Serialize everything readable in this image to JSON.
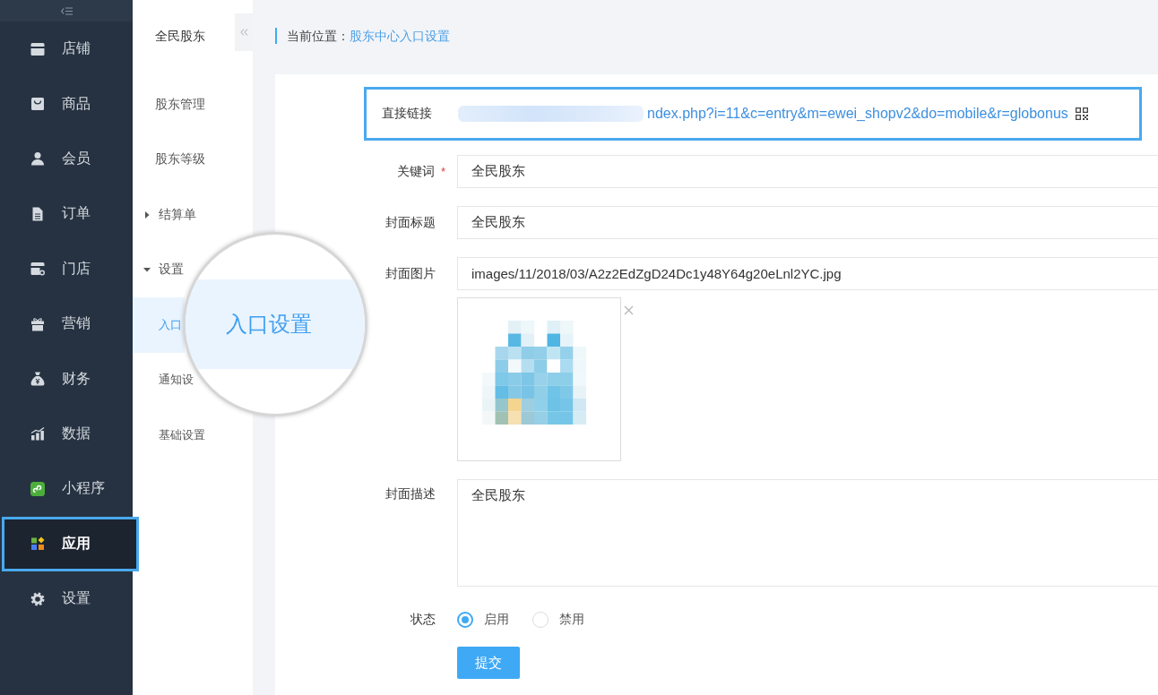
{
  "sidebar": {
    "items": [
      {
        "label": "店铺",
        "selected": false,
        "highlighted": false
      },
      {
        "label": "商品",
        "selected": false,
        "highlighted": false
      },
      {
        "label": "会员",
        "selected": false,
        "highlighted": false
      },
      {
        "label": "订单",
        "selected": false,
        "highlighted": false
      },
      {
        "label": "门店",
        "selected": false,
        "highlighted": false
      },
      {
        "label": "营销",
        "selected": false,
        "highlighted": false
      },
      {
        "label": "财务",
        "selected": false,
        "highlighted": false
      },
      {
        "label": "数据",
        "selected": false,
        "highlighted": false
      },
      {
        "label": "小程序",
        "selected": false,
        "highlighted": false
      },
      {
        "label": "应用",
        "selected": true,
        "highlighted": true
      },
      {
        "label": "设置",
        "selected": false,
        "highlighted": false
      }
    ]
  },
  "submenu": {
    "title": "全民股东",
    "items": [
      {
        "kind": "link",
        "label": "股东管理",
        "selected": false
      },
      {
        "kind": "link",
        "label": "股东等级",
        "selected": false
      },
      {
        "kind": "group",
        "label": "结算单",
        "expanded": false,
        "selected": false
      },
      {
        "kind": "group",
        "label": "设置",
        "expanded": true,
        "selected": false,
        "children": [
          {
            "label": "入口",
            "selected": true
          },
          {
            "label": "通知设",
            "selected": false
          },
          {
            "label": "基础设置",
            "selected": false
          }
        ]
      }
    ]
  },
  "magnifier": {
    "text": "入口设置"
  },
  "breadcrumb": {
    "label": "当前位置：",
    "current": "股东中心入口设置"
  },
  "form": {
    "direct_link": {
      "label": "直接链接",
      "value": "ndex.php?i=11&c=entry&m=ewei_shopv2&do=mobile&r=globonus",
      "redacted": true,
      "highlighted": true
    },
    "fields": [
      {
        "kind": "input",
        "label": "关键词",
        "required_mark": "*",
        "value": "全民股东"
      },
      {
        "kind": "input",
        "label": "封面标题",
        "value": "全民股东"
      },
      {
        "kind": "image",
        "label": "封面图片",
        "value": "images/11/2018/03/A2z2EdZgD24Dc1y48Y64g20eLnl2YC.jpg"
      },
      {
        "kind": "textarea",
        "label": "封面描述",
        "value": "全民股东"
      },
      {
        "kind": "radio",
        "label": "状态",
        "options": [
          {
            "label": "启用",
            "selected": true
          },
          {
            "label": "禁用",
            "selected": false
          }
        ]
      }
    ],
    "submit": "提交"
  }
}
